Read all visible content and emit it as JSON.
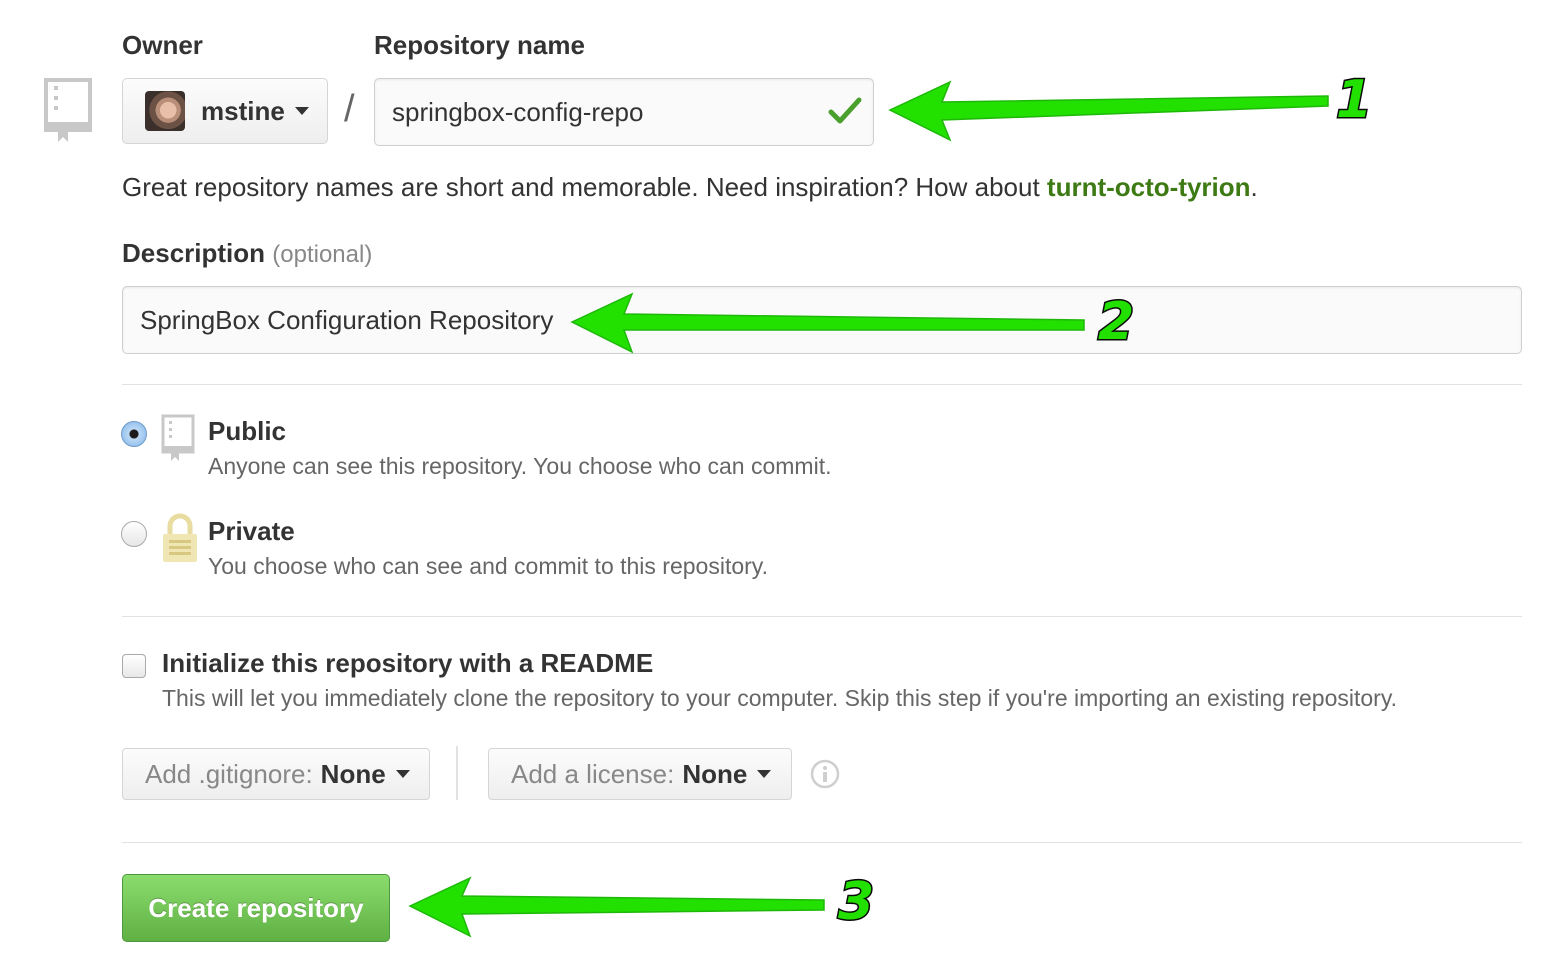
{
  "labels": {
    "owner": "Owner",
    "repository_name": "Repository name",
    "description": "Description",
    "description_optional": "(optional)"
  },
  "owner": {
    "name": "mstine",
    "icon": "avatar"
  },
  "separator": "/",
  "repo_name": {
    "value": "springbox-config-repo",
    "valid": true
  },
  "hint": {
    "text": "Great repository names are short and memorable. Need inspiration? How about ",
    "suggestion": "turnt-octo-tyrion",
    "end": "."
  },
  "description_value": "SpringBox Configuration Repository",
  "visibility": {
    "selected": "public",
    "public": {
      "title": "Public",
      "desc": "Anyone can see this repository. You choose who can commit.",
      "icon": "repo-icon"
    },
    "private": {
      "title": "Private",
      "desc": "You choose who can see and commit to this repository.",
      "icon": "lock-icon"
    }
  },
  "readme": {
    "checked": false,
    "title": "Initialize this repository with a README",
    "desc": "This will let you immediately clone the repository to your computer. Skip this step if you're importing an existing repository."
  },
  "gitignore": {
    "label": "Add .gitignore:",
    "value": "None"
  },
  "license": {
    "label": "Add a license:",
    "value": "None"
  },
  "create_button": "Create repository",
  "annotations": [
    {
      "number": "1",
      "color": "#22e000"
    },
    {
      "number": "2",
      "color": "#22e000"
    },
    {
      "number": "3",
      "color": "#22e000"
    }
  ]
}
